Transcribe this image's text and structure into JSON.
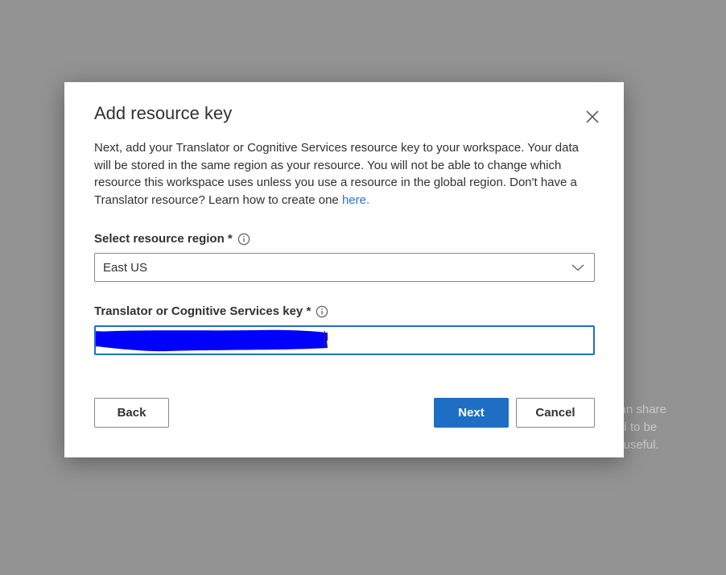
{
  "backdrop": {
    "lines": [
      "can share",
      "ed to be",
      "e useful."
    ]
  },
  "dialog": {
    "title": "Add resource key",
    "close_icon": "close-icon",
    "description_text": "Next, add your Translator or Cognitive Services resource key to your workspace. Your data will be stored in the same region as your resource. You will not be able to change which resource this workspace uses unless you use a resource in the global region. Don't have a Translator resource? Learn how to create one ",
    "description_link": "here."
  },
  "region_field": {
    "label": "Select resource region *",
    "info_icon": "info-icon",
    "value": "East US",
    "chevron_icon": "chevron-down-icon"
  },
  "key_field": {
    "label": "Translator or Cognitive Services key *",
    "info_icon": "info-icon",
    "redacted_color": "#0000ff"
  },
  "buttons": {
    "back": "Back",
    "next": "Next",
    "cancel": "Cancel"
  },
  "colors": {
    "primary": "#1e6fc4",
    "link": "#2e6fd0",
    "overlay": "#939393"
  }
}
